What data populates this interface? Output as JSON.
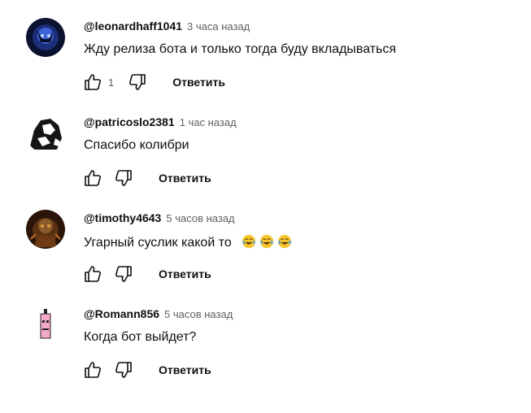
{
  "comments": [
    {
      "author": "@leonardhaff1041",
      "time": "3 часа назад",
      "text": "Жду релиза бота и только тогда буду вкладываться",
      "likes": "1",
      "reply_label": "Ответить",
      "emojis": []
    },
    {
      "author": "@patricoslo2381",
      "time": "1 час назад",
      "text": "Спасибо колибри",
      "likes": "",
      "reply_label": "Ответить",
      "emojis": []
    },
    {
      "author": "@timothy4643",
      "time": "5 часов назад",
      "text": "Угарный суслик какой то",
      "likes": "",
      "reply_label": "Ответить",
      "emojis": [
        "face-with-tears-of-joy",
        "face-with-tears-of-joy",
        "face-with-tears-of-joy"
      ]
    },
    {
      "author": "@Romann856",
      "time": "5 часов назад",
      "text": "Когда бот выйдет?",
      "likes": "",
      "reply_label": "Ответить",
      "emojis": []
    }
  ],
  "icons": {
    "like": "thumbs-up-icon",
    "dislike": "thumbs-down-icon"
  },
  "colors": {
    "text": "#0f0f0f",
    "secondary": "#606060",
    "background": "#ffffff"
  }
}
